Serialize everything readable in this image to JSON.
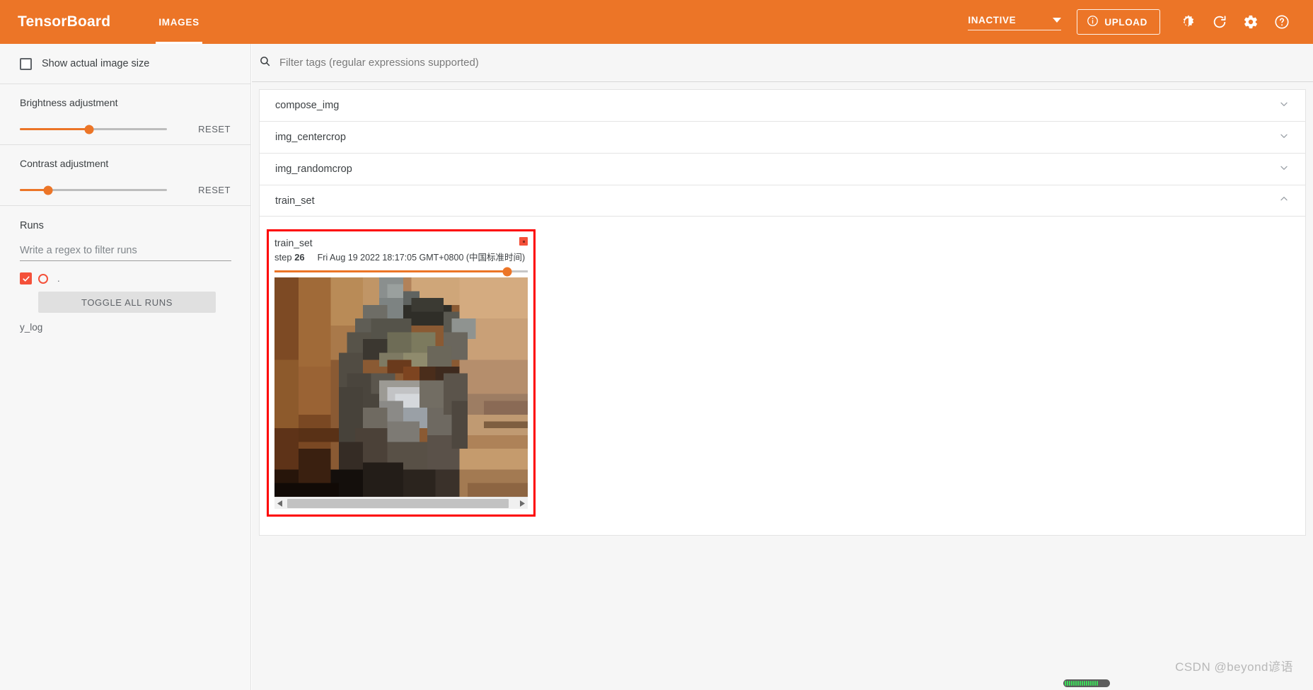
{
  "header": {
    "brand": "TensorBoard",
    "tabs": [
      {
        "label": "IMAGES",
        "active": true
      }
    ],
    "status_select": {
      "value": "INACTIVE",
      "icon": "chevron-down-icon"
    },
    "upload_button": {
      "label": "UPLOAD",
      "icon": "info-circle-icon"
    },
    "icons": [
      {
        "name": "brightness-icon",
        "title": "Toggle dark mode"
      },
      {
        "name": "refresh-icon",
        "title": "Refresh"
      },
      {
        "name": "settings-gear-icon",
        "title": "Settings"
      },
      {
        "name": "help-circle-icon",
        "title": "Help"
      }
    ],
    "accent_color": "#ec7527"
  },
  "sidebar": {
    "show_actual_image_size": {
      "label": "Show actual image size",
      "checked": false
    },
    "brightness": {
      "label": "Brightness adjustment",
      "reset_label": "RESET",
      "value_pct": 47
    },
    "contrast": {
      "label": "Contrast adjustment",
      "reset_label": "RESET",
      "value_pct": 19
    },
    "runs": {
      "title": "Runs",
      "filter_placeholder": "Write a regex to filter runs",
      "filter_value": "",
      "items": [
        {
          "label": ".",
          "checked": true,
          "color": "#f4513a"
        }
      ],
      "toggle_all_label": "TOGGLE ALL RUNS",
      "footer_label": "y_log"
    }
  },
  "main": {
    "filter": {
      "placeholder": "Filter tags (regular expressions supported)",
      "value": "",
      "icon": "search-icon"
    },
    "tags": [
      {
        "name": "compose_img",
        "expanded": false,
        "icon": "chevron-down-icon"
      },
      {
        "name": "img_centercrop",
        "expanded": false,
        "icon": "chevron-down-icon"
      },
      {
        "name": "img_randomcrop",
        "expanded": false,
        "icon": "chevron-down-icon"
      },
      {
        "name": "train_set",
        "expanded": true,
        "icon": "chevron-up-icon"
      }
    ],
    "image_card": {
      "run_label": "train_set",
      "step_prefix": "step",
      "step_value": "26",
      "timestamp": "Fri Aug 19 2022 18:17:05 GMT+0800 (中国标准时间)",
      "swatch_color": "#f4513a",
      "step_slider_pct": 92,
      "selection_border_color": "#fd0000",
      "scrollbar": {
        "left_arrow": "arrow-left-icon",
        "right_arrow": "arrow-right-icon"
      }
    }
  },
  "footer": {
    "watermark": "CSDN @beyond谚语"
  }
}
